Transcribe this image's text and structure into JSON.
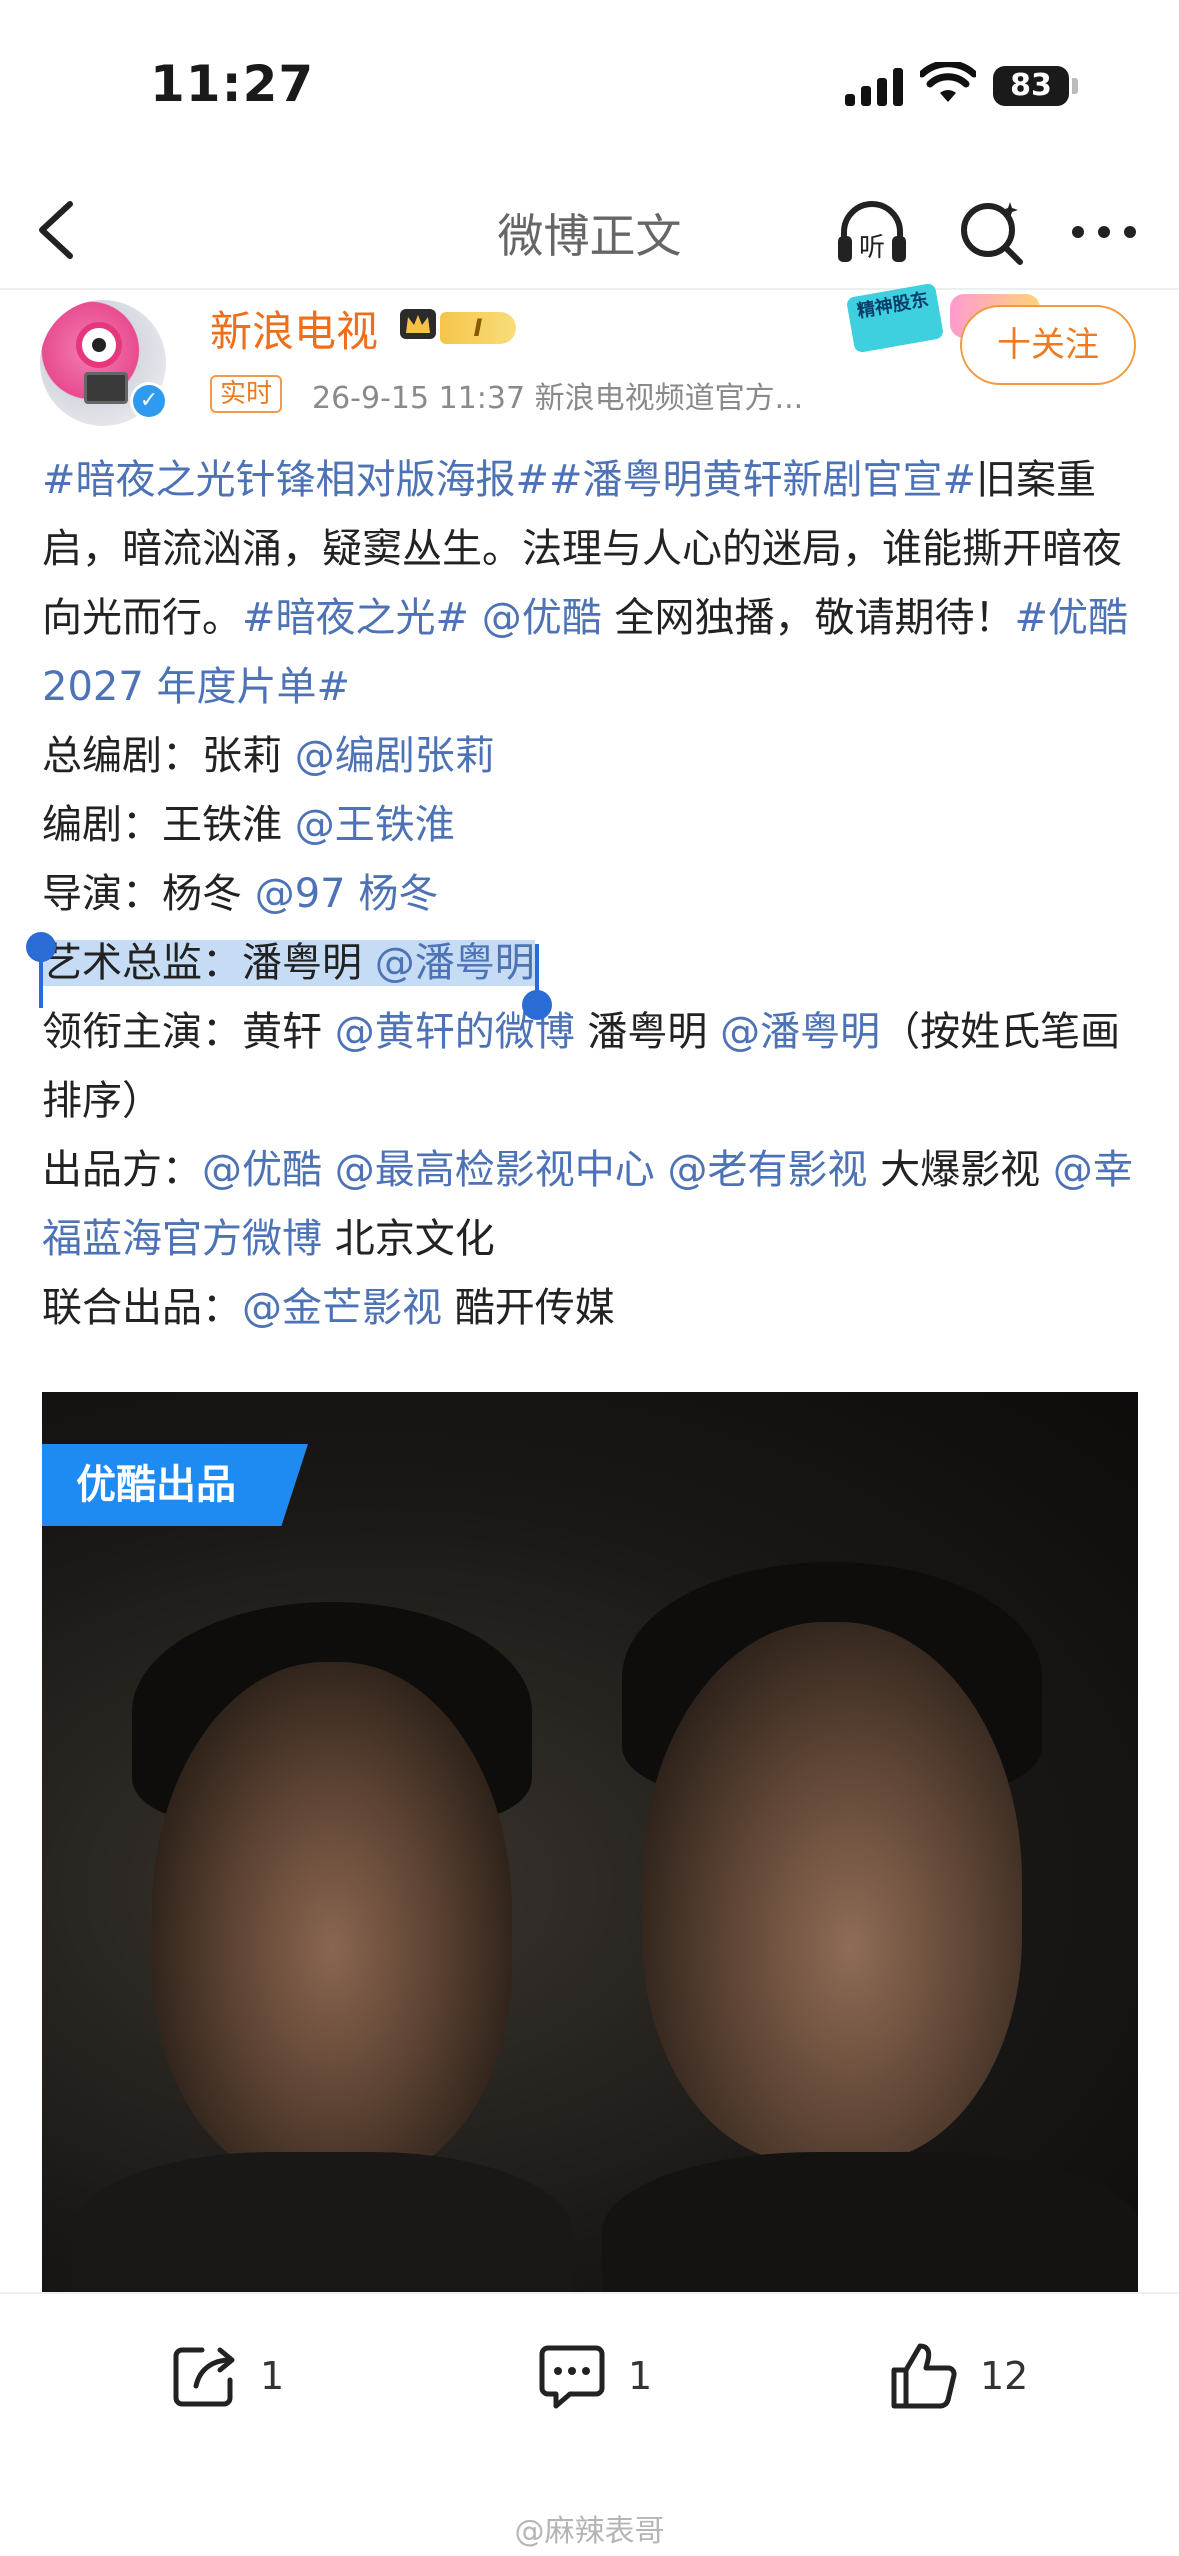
{
  "status_bar": {
    "time": "11:27",
    "battery": "83"
  },
  "nav": {
    "title": "微博正文",
    "back_icon": "back-arrow-icon",
    "listen_label": "听"
  },
  "post": {
    "author": "新浪电视",
    "level_badge": "I",
    "tag": "实时",
    "meta": "26-9-15 11:37  新浪电视频道官方...",
    "follow_label": "十关注",
    "promo_text": "精神股东",
    "lines": {
      "l1_link": "#暗夜之光针锋相对版海报##潘粤明黄轩新剧官宣#",
      "l2_text": "旧案重启，暗流汹涌，疑窦丛生。法理与人心的迷局，谁能撕开暗夜向光而行。",
      "l2_link1": "#暗夜之光#",
      "l2_space": " ",
      "l2_link2": "@优酷",
      "l2_text2": " 全网独播，敬请期待！",
      "l2_link3": "#优酷 2027 年度片单#",
      "chief_writer_label": "总编剧：张莉 ",
      "chief_writer_link": "@编剧张莉",
      "writer_label": "编剧：王铁淮 ",
      "writer_link": "@王铁淮",
      "director_label": "导演：杨冬 ",
      "director_link": "@97 杨冬",
      "art_label": "艺术总监：潘粤明 ",
      "art_link": "@潘粤明",
      "lead_label": "领衔主演：黄轩 ",
      "lead_link1": "@黄轩的微博",
      "lead_text2": " 潘粤明 ",
      "lead_link2": "@潘粤明",
      "lead_text3": "（按姓氏笔画排序）",
      "producer_label": "出品方：",
      "producer_link1": "@优酷",
      "producer_link2": "@最高检影视中心",
      "producer_link3": "@老有影视",
      "producer_text1": " 大爆影视 ",
      "producer_link4": "@幸福蓝海官方微博",
      "producer_text2": " 北京文化",
      "co_label": "联合出品：",
      "co_link": "@金芒影视",
      "co_text": " 酷开传媒"
    },
    "poster_badge": "优酷出品"
  },
  "actions": {
    "repost_count": "1",
    "comment_count": "1",
    "like_count": "12"
  },
  "watermark": "@麻辣表哥",
  "colors": {
    "link": "#4d73b6",
    "accent": "#ee7a22",
    "selection": "#c6dcf5",
    "handle": "#2a6bd6"
  }
}
